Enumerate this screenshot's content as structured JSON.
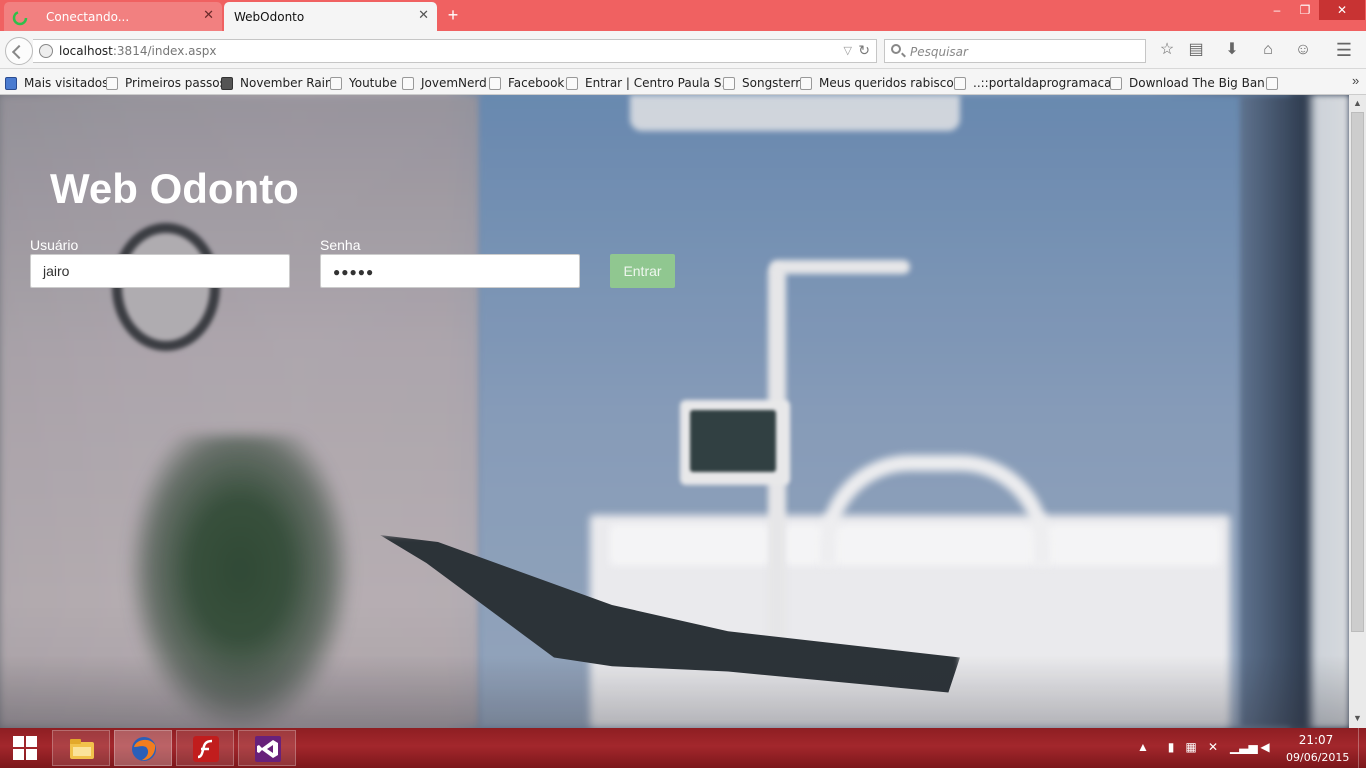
{
  "browser": {
    "tabs": [
      {
        "label": "Conectando...",
        "state": "loading"
      },
      {
        "label": "WebOdonto",
        "state": "active"
      }
    ],
    "new_tab_label": "+",
    "window_controls": {
      "minimize": "–",
      "maximize": "❐",
      "close": "✕"
    },
    "url": {
      "host": "localhost",
      "path": ":3814/index.aspx"
    },
    "search_placeholder": "Pesquisar",
    "toolbar_icons": [
      "star-icon",
      "library-icon",
      "download-icon",
      "home-icon",
      "chat-icon",
      "menu-icon"
    ],
    "bookmarks": [
      "Mais visitados",
      "Primeiros passos",
      "November Rain",
      "Youtube",
      "JovemNerd",
      "Facebook",
      "Entrar | Centro Paula S...",
      "Songsterr",
      "Meus queridos rabiscos.",
      "..::portaldaprogramaca...",
      "Download The Big Ban..."
    ],
    "bookmarks_overflow": "»"
  },
  "page": {
    "title": "Web Odonto",
    "usuario_label": "Usuário",
    "usuario_value": "jairo",
    "senha_label": "Senha",
    "senha_value": "●●●●●",
    "submit_label": "Entrar",
    "colors": {
      "submit_bg": "#90c790",
      "title": "#ffffff",
      "label": "#ffffff"
    }
  },
  "taskbar": {
    "apps": [
      "file-explorer-icon",
      "firefox-icon",
      "flash-icon",
      "visual-studio-icon"
    ],
    "tray_icons": [
      "tray-up-arrow-icon",
      "battery-icon",
      "action-center-icon",
      "network-x-icon",
      "signal-icon",
      "volume-icon"
    ],
    "time": "21:07",
    "date": "09/06/2015",
    "accent": "#a3272c"
  }
}
